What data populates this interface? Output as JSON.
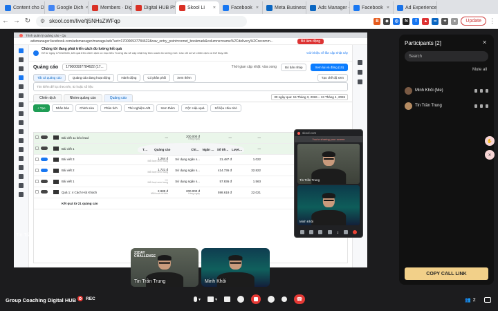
{
  "browser": {
    "tabs": [
      {
        "label": "Content cho Di",
        "color": "#1a73e8",
        "icon": "doc-icon"
      },
      {
        "label": "Google Dịch",
        "color": "#4285f4",
        "icon": "translate-icon"
      },
      {
        "label": "Members · Digi",
        "color": "#d93025",
        "icon": "skool-icon"
      },
      {
        "label": "Digital HUB Ph",
        "color": "#d93025",
        "icon": "skool-icon"
      },
      {
        "label": "Skool Li",
        "color": "#d93025",
        "icon": "skool-icon",
        "active": true
      },
      {
        "label": "Facebook",
        "color": "#1877f2",
        "icon": "facebook-icon"
      },
      {
        "label": "Meta Business",
        "color": "#0a66c2",
        "icon": "meta-icon"
      },
      {
        "label": "Ads Manager -",
        "color": "#0a66c2",
        "icon": "meta-icon"
      },
      {
        "label": "Facebook",
        "color": "#1877f2",
        "icon": "facebook-icon"
      },
      {
        "label": "Ad Experience",
        "color": "#1a73e8",
        "icon": "ads-icon"
      }
    ],
    "url": "skool.com/live/tj5NHsZWFqp",
    "update_label": "Update"
  },
  "share": {
    "inner_tab": "Trình quản lý quảng cáo - Qu",
    "inner_url": "adsmanager.facebook.com/adsmanager/manage/ads?act=170000937784622&nav_entry_point=comet_bookmark&columns=name%2Cdelivery%2Crecomm...",
    "sharing_badge": "Bỏ làm động",
    "notice_title": "Chúng tôi đang phát triển cách đo lường kết quả",
    "notice_body": "Kể từ ngày 17/03/2026, kết quả trên chiến dịch có mục tiêu Tương tác sẽ cập nhật tùy theo cách đo lường mới. Các chỉ số về chiến dịch có thể thay đổi.",
    "notice_action": "Giới thiệu về lần cập nhật này",
    "page_title": "Quảng cáo",
    "account": "170000937784622 (17...",
    "updated": "Thời gian cập nhật: vừa xong",
    "discard": "Bỏ bản nháp",
    "review": "Xem lại và đăng (10)",
    "subnav": [
      "Tất cả quảng cáo",
      "Quảng cáo đang hoạt động",
      "Hành động",
      "Có phân phối",
      "Xem thêm"
    ],
    "custom_view": "Tạo chế độ xem",
    "search_placeholder": "Tìm kiếm để lọc theo tên, ID hoặc số liệu",
    "levels": [
      "Chiến dịch",
      "Nhóm quảng cáo",
      "Quảng cáo"
    ],
    "daterange": "30 ngày qua: 15 Tháng 3, 2026 – 13 Tháng 4, 2026",
    "toolbar": {
      "create": "+ Tạo",
      "duplicate": "Nhân bản",
      "edit": "Chỉnh sửa",
      "analyze": "Phân tích",
      "abtest": "Thử nghiệm A/B",
      "more": "Xem thêm",
      "columns": "Cột: Hiệu quả",
      "breakdown": "Số liệu chia nhỏ"
    },
    "table": {
      "headers": [
        "Tắt...",
        "Quảng cáo",
        "Chi trên kết quả",
        "Ngân sách",
        "Số tiền đã chi tiêu",
        "Lượt hiển thị"
      ],
      "rows": [
        {
          "name": "Bài viết 11 kéo lead",
          "cpr": "—",
          "budget": "200.000 đ",
          "budget_sub": "Hàng ngày",
          "spent": "—",
          "impr": "—",
          "sel": true,
          "on": false
        },
        {
          "name": "Bài viết 1",
          "cpr": "—",
          "budget": "140.000 đ",
          "budget_sub": "Hàng ngày",
          "spent": "—",
          "impr": "—",
          "sel": true,
          "on": false
        },
        {
          "name": "Bài viết 3",
          "cpr": "1.264 đ",
          "cpr_sub": "Mỗi lượt xem trang",
          "budget": "Sử dụng ngân s...",
          "spent": "21.487 đ",
          "impr": "1.022",
          "on": true
        },
        {
          "name": "Bài viết 2",
          "cpr": "1.721 đ",
          "cpr_sub": "Mỗi lượt xem trang",
          "budget": "Sử dụng ngân s...",
          "spent": "414.736 đ",
          "impr": "32.822",
          "on": true
        },
        {
          "name": "Bài viết 1",
          "cpr": "—",
          "cpr_sub": "Mỗi lượt xem trang",
          "budget": "Sử dụng ngân s...",
          "spent": "57.836 đ",
          "impr": "1.563",
          "on": false
        },
        {
          "name": "Quả 1: 4 Cách Hút Khách",
          "cpr": "2.989 đ",
          "cpr_sub": "Mỗi lượt chi tiêu",
          "budget": "200.000 đ",
          "budget_sub": "Hàng ngày",
          "spent": "598.618 đ",
          "impr": "22.021",
          "on": false
        }
      ],
      "total": "Kết quả từ 21 quảng cáo"
    },
    "presenter": "Tin Trần Trung"
  },
  "minicall": {
    "site": "skool.com",
    "warning": "You're sharing your screen",
    "tiles": [
      "Tin Trần Trung",
      "Minh Khôi"
    ],
    "badge": "2"
  },
  "videos": [
    {
      "name": "Tin Trần Trung",
      "banner": "21DAY CHALLENGE"
    },
    {
      "name": "Minh Khôi"
    }
  ],
  "participants": {
    "title": "Participants [2]",
    "search_placeholder": "Search",
    "mute_all": "Mute all",
    "list": [
      {
        "name": "Minh Khôi (Me)"
      },
      {
        "name": "Tin Trần Trung"
      }
    ],
    "copy_label": "COPY CALL LINK"
  },
  "meeting": {
    "title": "Group Coaching Digital HUB",
    "rec_label": "REC",
    "participant_count": "2"
  }
}
